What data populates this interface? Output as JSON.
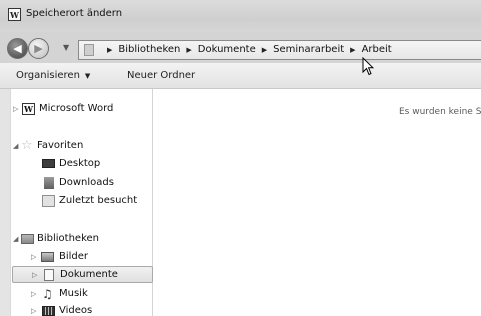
{
  "window": {
    "title": "Speicherort ändern",
    "app_icon_letter": "W"
  },
  "address_bar": {
    "crumbs": [
      "Bibliotheken",
      "Dokumente",
      "Seminararbeit",
      "Arbeit"
    ]
  },
  "toolbar": {
    "organize_label": "Organisieren",
    "new_folder_label": "Neuer Ordner"
  },
  "nav": {
    "word": {
      "label": "Microsoft Word",
      "icon_letter": "W"
    },
    "favorites": {
      "label": "Favoriten",
      "items": [
        "Desktop",
        "Downloads",
        "Zuletzt besucht"
      ]
    },
    "libraries": {
      "label": "Bibliotheken",
      "items": [
        "Bilder",
        "Dokumente",
        "Musik",
        "Videos"
      ]
    }
  },
  "content": {
    "empty_message": "Es wurden keine S"
  }
}
